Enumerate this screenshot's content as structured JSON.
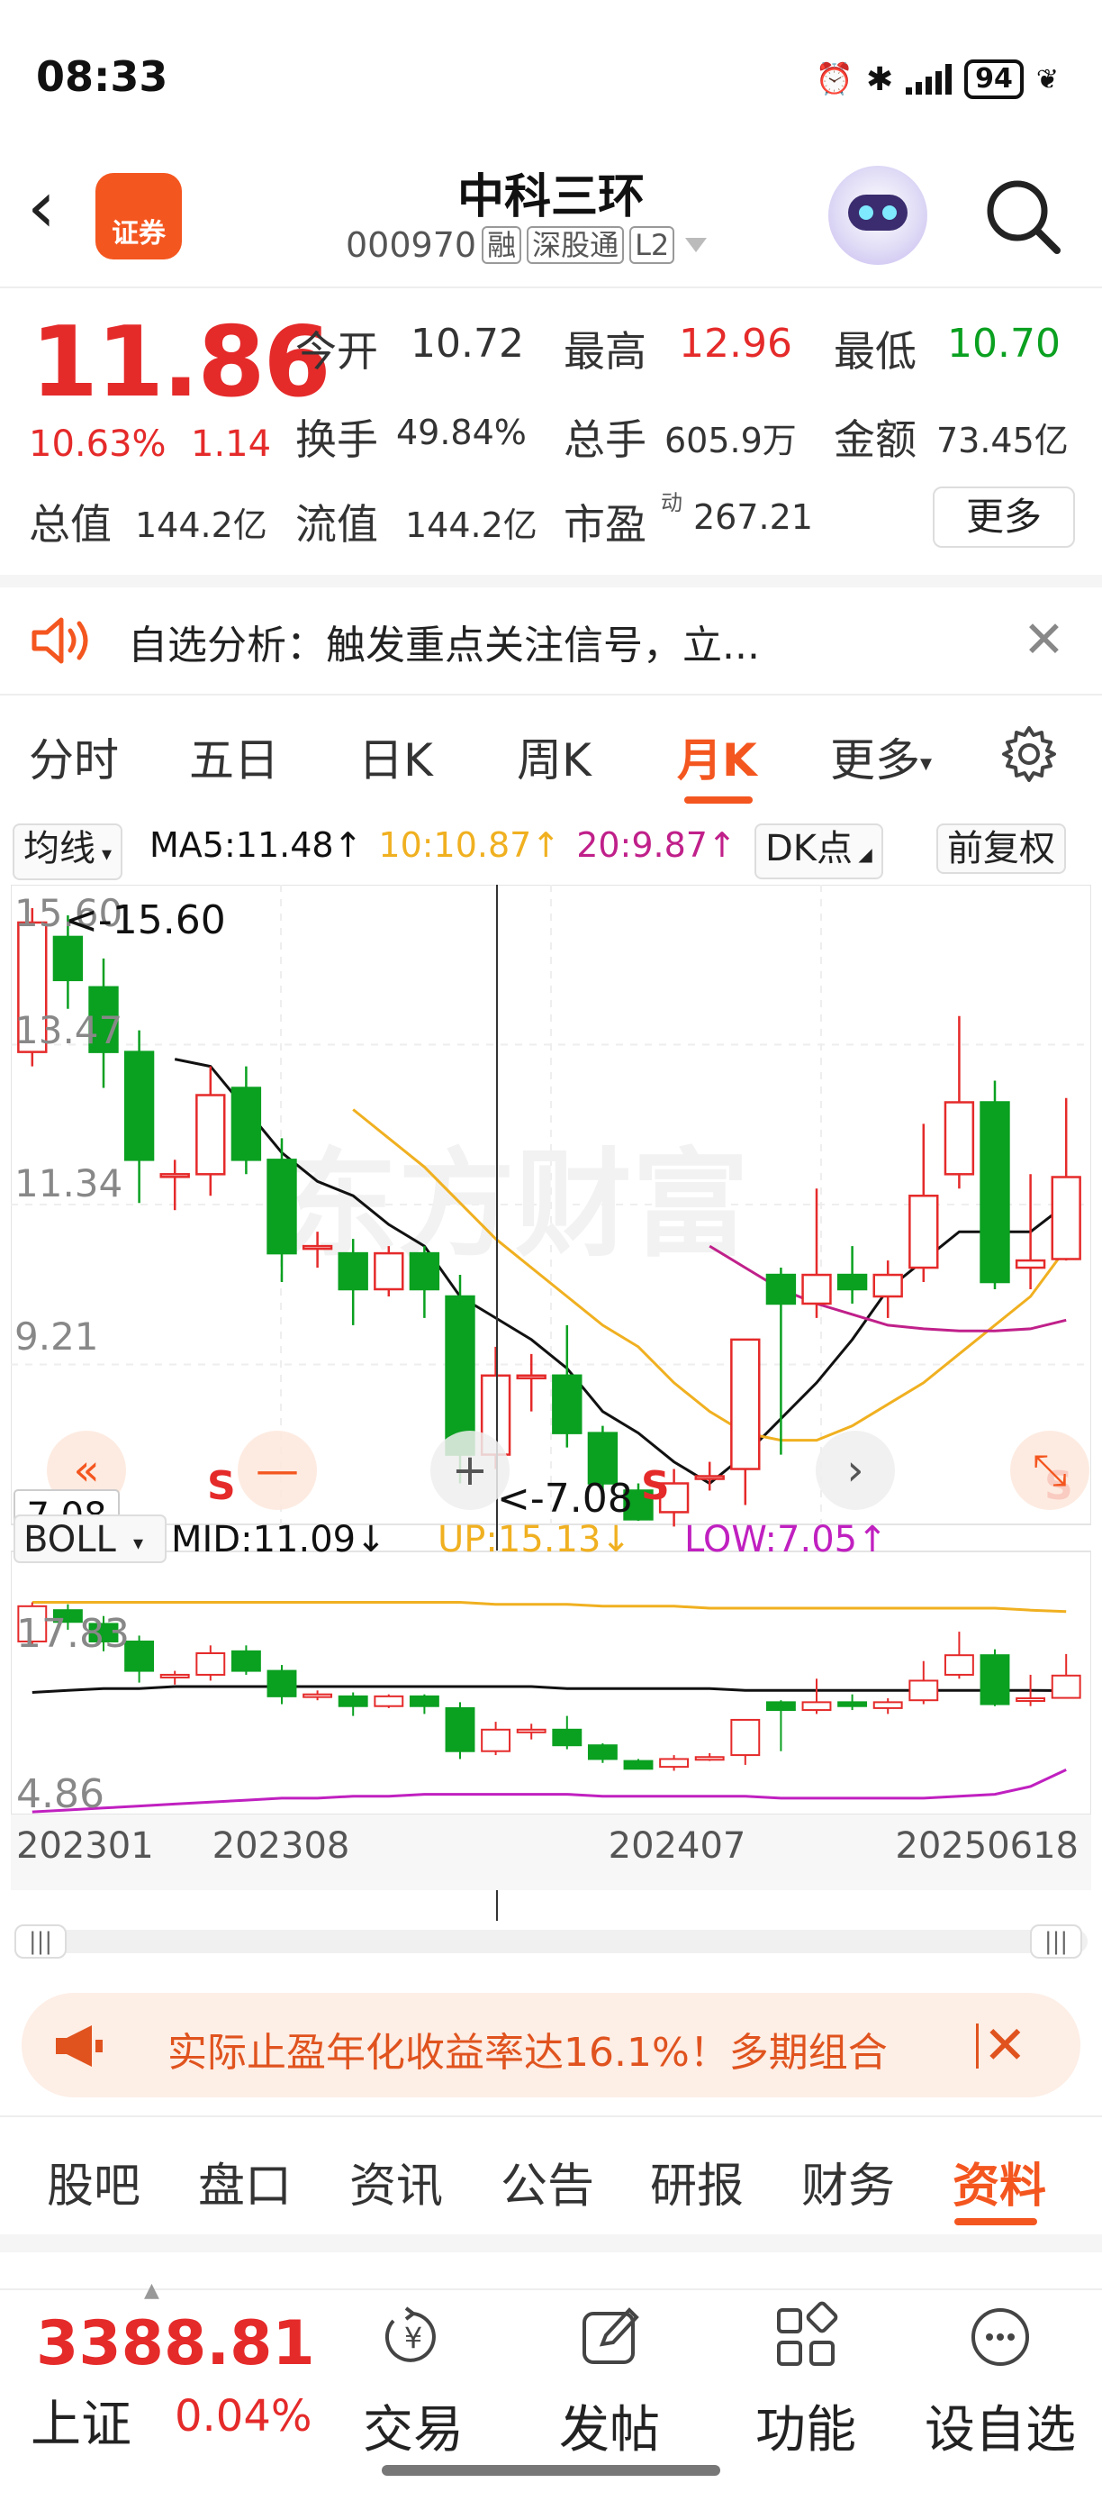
{
  "status": {
    "time": "08:33",
    "battery": "94"
  },
  "header": {
    "broker_logo": "证券",
    "stock_name": "中科三环",
    "stock_code": "000970",
    "tag_margin": "融",
    "tag_connect": "深股通",
    "tag_level": "L2"
  },
  "quote": {
    "price": "11.86",
    "change_pct": "10.63%",
    "change_abs": "1.14",
    "open_label": "今开",
    "open": "10.72",
    "high_label": "最高",
    "high": "12.96",
    "low_label": "最低",
    "low": "10.70",
    "turnover_label": "换手",
    "turnover": "49.84%",
    "volume_label": "总手",
    "volume": "605.9万",
    "amount_label": "金额",
    "amount": "73.45亿",
    "mktcap_label": "总值",
    "mktcap": "144.2亿",
    "float_label": "流值",
    "float": "144.2亿",
    "pe_label": "市盈",
    "pe_sup": "动",
    "pe": "267.21",
    "more_label": "更多"
  },
  "notice": {
    "text": "自选分析：触发重点关注信号，立..."
  },
  "tabs": [
    "分时",
    "五日",
    "日K",
    "周K",
    "月K",
    "更多"
  ],
  "active_tab": "月K",
  "indicators": {
    "ma_btn": "均线",
    "ma5": "MA5:11.48↑",
    "ma10": "10:10.87↑",
    "ma20": "20:9.87↑",
    "dk_btn": "DK点",
    "adj_btn": "前复权",
    "boll_btn": "BOLL",
    "boll_mid": "MID:11.09↓",
    "boll_up": "UP:15.13↓",
    "boll_low": "LOW:7.05↑"
  },
  "chart_data": {
    "type": "candlestick",
    "period": "monthly",
    "y_ticks": [
      "15.60",
      "13.47",
      "11.34",
      "9.21",
      "7.08"
    ],
    "ylim": [
      7.08,
      15.6
    ],
    "max_marker": "<-15.60",
    "min_marker": "<-7.08",
    "cursor_label": "7.08",
    "boll_y_ticks": [
      "17.83",
      "4.86"
    ],
    "x_labels": [
      "202301",
      "202308",
      "202407",
      "20250618"
    ],
    "watermark": "东方财富",
    "signal_marks": [
      "S",
      "S",
      "S"
    ],
    "candles": [
      {
        "o": 13.6,
        "c": 15.4,
        "h": 15.6,
        "l": 13.4
      },
      {
        "o": 15.2,
        "c": 14.6,
        "h": 15.5,
        "l": 14.2
      },
      {
        "o": 14.5,
        "c": 13.6,
        "h": 14.9,
        "l": 13.1
      },
      {
        "o": 13.6,
        "c": 12.1,
        "h": 13.9,
        "l": 11.5
      },
      {
        "o": 11.9,
        "c": 11.9,
        "h": 12.1,
        "l": 11.4
      },
      {
        "o": 11.9,
        "c": 13.0,
        "h": 13.4,
        "l": 11.6
      },
      {
        "o": 13.1,
        "c": 12.1,
        "h": 13.4,
        "l": 11.9
      },
      {
        "o": 12.1,
        "c": 10.8,
        "h": 12.4,
        "l": 10.4
      },
      {
        "o": 10.9,
        "c": 10.9,
        "h": 11.1,
        "l": 10.6
      },
      {
        "o": 10.8,
        "c": 10.3,
        "h": 11.0,
        "l": 9.8
      },
      {
        "o": 10.3,
        "c": 10.8,
        "h": 10.9,
        "l": 10.2
      },
      {
        "o": 10.8,
        "c": 10.3,
        "h": 10.9,
        "l": 9.9
      },
      {
        "o": 10.2,
        "c": 8.0,
        "h": 10.5,
        "l": 7.6
      },
      {
        "o": 8.0,
        "c": 9.1,
        "h": 9.5,
        "l": 7.8
      },
      {
        "o": 9.1,
        "c": 9.1,
        "h": 9.4,
        "l": 8.6
      },
      {
        "o": 9.1,
        "c": 8.3,
        "h": 9.8,
        "l": 8.1
      },
      {
        "o": 8.3,
        "c": 7.6,
        "h": 8.4,
        "l": 7.4
      },
      {
        "o": 7.5,
        "c": 7.1,
        "h": 7.6,
        "l": 7.08
      },
      {
        "o": 7.2,
        "c": 7.6,
        "h": 7.8,
        "l": 7.0
      },
      {
        "o": 7.7,
        "c": 7.7,
        "h": 7.9,
        "l": 7.5
      },
      {
        "o": 7.8,
        "c": 9.6,
        "h": 9.6,
        "l": 7.3
      },
      {
        "o": 10.5,
        "c": 10.1,
        "h": 10.6,
        "l": 8.0
      },
      {
        "o": 10.1,
        "c": 10.5,
        "h": 11.7,
        "l": 9.9
      },
      {
        "o": 10.5,
        "c": 10.3,
        "h": 10.9,
        "l": 10.1
      },
      {
        "o": 10.2,
        "c": 10.5,
        "h": 10.7,
        "l": 9.9
      },
      {
        "o": 10.6,
        "c": 11.6,
        "h": 12.6,
        "l": 10.4
      },
      {
        "o": 11.9,
        "c": 12.9,
        "h": 14.1,
        "l": 11.7
      },
      {
        "o": 12.9,
        "c": 10.4,
        "h": 13.2,
        "l": 10.3
      },
      {
        "o": 10.6,
        "c": 10.7,
        "h": 11.9,
        "l": 10.3
      },
      {
        "o": 10.72,
        "c": 11.86,
        "h": 12.96,
        "l": 10.7
      }
    ],
    "series": [
      {
        "name": "MA5",
        "color": "#111111",
        "values": [
          null,
          null,
          null,
          null,
          13.5,
          13.4,
          12.8,
          12.2,
          11.8,
          11.6,
          11.2,
          10.9,
          10.2,
          9.9,
          9.6,
          9.2,
          8.6,
          8.3,
          7.9,
          7.6,
          8.0,
          8.5,
          9.0,
          9.6,
          10.3,
          10.7,
          11.1,
          11.1,
          11.1,
          11.48
        ]
      },
      {
        "name": "MA10",
        "color": "#f0b020",
        "values": [
          null,
          null,
          null,
          null,
          null,
          null,
          null,
          null,
          null,
          12.8,
          12.4,
          12.0,
          11.5,
          11.0,
          10.6,
          10.2,
          9.8,
          9.5,
          9.0,
          8.6,
          8.3,
          8.2,
          8.2,
          8.4,
          8.7,
          9.0,
          9.4,
          9.8,
          10.2,
          10.87
        ]
      },
      {
        "name": "20",
        "color": "#c0208a",
        "values": [
          null,
          null,
          null,
          null,
          null,
          null,
          null,
          null,
          null,
          null,
          null,
          null,
          null,
          null,
          null,
          null,
          null,
          null,
          null,
          10.9,
          10.6,
          10.3,
          10.1,
          9.95,
          9.8,
          9.75,
          9.72,
          9.72,
          9.75,
          9.87
        ]
      }
    ],
    "boll": {
      "up": [
        15.6,
        15.6,
        15.6,
        15.6,
        15.6,
        15.6,
        15.6,
        15.6,
        15.6,
        15.6,
        15.6,
        15.6,
        15.6,
        15.5,
        15.5,
        15.5,
        15.4,
        15.4,
        15.4,
        15.3,
        15.3,
        15.3,
        15.3,
        15.3,
        15.3,
        15.3,
        15.3,
        15.3,
        15.2,
        15.13
      ],
      "mid": [
        11.0,
        11.1,
        11.2,
        11.2,
        11.3,
        11.3,
        11.3,
        11.3,
        11.3,
        11.3,
        11.3,
        11.3,
        11.3,
        11.3,
        11.3,
        11.2,
        11.2,
        11.2,
        11.2,
        11.2,
        11.1,
        11.1,
        11.1,
        11.1,
        11.1,
        11.1,
        11.1,
        11.1,
        11.1,
        11.09
      ],
      "low": [
        4.9,
        5.0,
        5.1,
        5.2,
        5.3,
        5.4,
        5.5,
        5.6,
        5.6,
        5.7,
        5.7,
        5.8,
        5.8,
        5.8,
        5.8,
        5.8,
        5.7,
        5.7,
        5.7,
        5.7,
        5.7,
        5.6,
        5.6,
        5.6,
        5.6,
        5.6,
        5.7,
        5.8,
        6.2,
        7.05
      ]
    },
    "colors": {
      "up": "#e52a2a",
      "down": "#0aa020"
    }
  },
  "ad": {
    "text": "实际止盈年化收益率达16.1%！多期组合"
  },
  "bottom_tabs": [
    "股吧",
    "盘口",
    "资讯",
    "公告",
    "研报",
    "财务",
    "资料"
  ],
  "active_bottom_tab": "资料",
  "index": {
    "value": "3388.81",
    "name": "上证",
    "pct": "0.04%"
  },
  "dock": [
    "交易",
    "发帖",
    "功能",
    "设自选"
  ]
}
